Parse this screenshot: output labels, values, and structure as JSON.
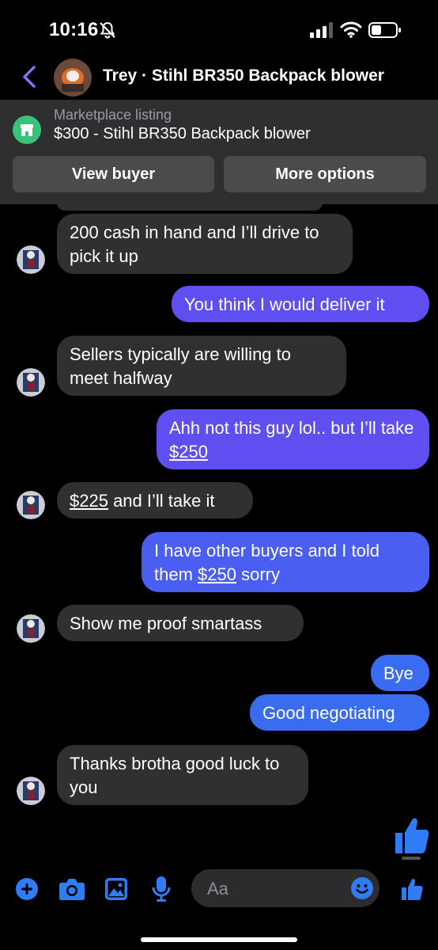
{
  "status": {
    "time": "10:16"
  },
  "header": {
    "title": "Trey · Stihl BR350 Backpack blower"
  },
  "listing": {
    "caption": "Marketplace listing",
    "title": "$300 - Stihl BR350 Backpack blower",
    "view_buyer": "View buyer",
    "more_options": "More options"
  },
  "messages": [
    {
      "dir": "in",
      "text": "200 cash in hand and I’ll drive to pick it up"
    },
    {
      "dir": "out",
      "text": "You think I would deliver it"
    },
    {
      "dir": "in",
      "text": "Sellers typically are willing to meet halfway"
    },
    {
      "dir": "out",
      "text": "Ahh not this guy lol.. but I’ll take $250"
    },
    {
      "dir": "in",
      "text": "$225 and I’ll take it"
    },
    {
      "dir": "out",
      "text": "I have other buyers and I told them $250 sorry"
    },
    {
      "dir": "in",
      "text": "Show me proof smartass"
    },
    {
      "dir": "out",
      "text": "Bye"
    },
    {
      "dir": "out",
      "text": "Good negotiating"
    },
    {
      "dir": "in",
      "text": "Thanks brotha good luck to you"
    }
  ],
  "composer": {
    "placeholder": "Aa"
  },
  "icons": {
    "accent": "#2e7cf6",
    "outgoing_bubble": "#5f4ff0",
    "incoming_bubble": "#303033",
    "back": "chevron-left-icon",
    "silent": "bell-slash-icon"
  }
}
